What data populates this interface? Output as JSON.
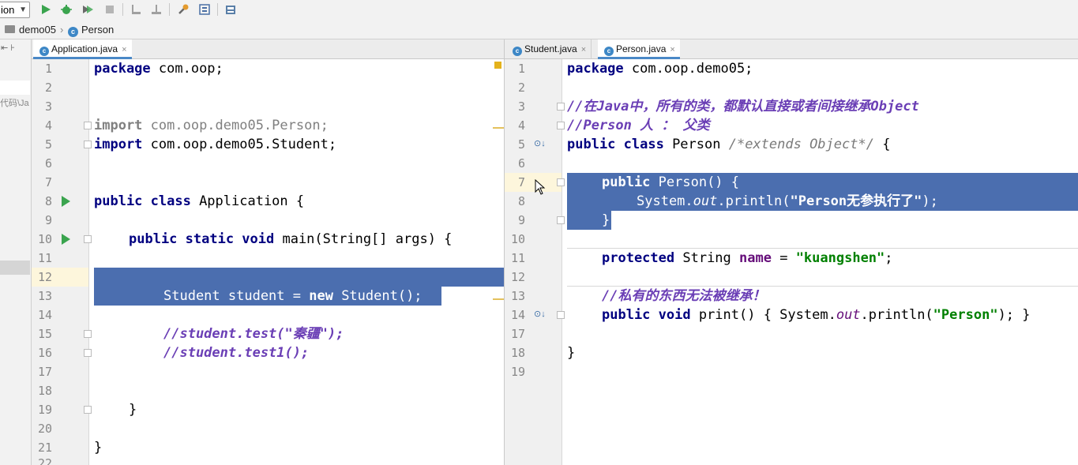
{
  "toolbar": {
    "run_config": "ion",
    "icons": [
      "run-icon",
      "debug-icon",
      "coverage-icon",
      "stop-icon",
      "build-icon",
      "rebuild-icon",
      "settings-icon",
      "structure-icon",
      "sdk-icon"
    ]
  },
  "breadcrumb": {
    "items": [
      "demo05",
      "Person"
    ]
  },
  "left_strip": {
    "label": "代码\\Ja"
  },
  "left_editor": {
    "tabs": [
      {
        "label": "Application.java",
        "active": true
      }
    ],
    "lines": [
      "1",
      "2",
      "3",
      "4",
      "5",
      "6",
      "7",
      "8",
      "9",
      "10",
      "11",
      "12",
      "13",
      "14",
      "15",
      "16",
      "17",
      "18",
      "19",
      "20",
      "21",
      "22"
    ],
    "code": {
      "l1_kw": "package",
      "l1_rest": " com.oop;",
      "l4_kw": "import",
      "l4_rest": " com.oop.demo05.Person;",
      "l5_kw": "import",
      "l5_rest": " com.oop.demo05.Student;",
      "l8_kw": "public class",
      "l8_rest": " Application {",
      "l10_kw1": "public static void",
      "l10_rest": " main(String[] args) {",
      "l13_a": "Student student = ",
      "l13_kw": "new",
      "l13_b": " Student();",
      "l15": "//student.test(\"秦疆\");",
      "l16": "//student.test1();",
      "l19": "}",
      "l21": "}"
    }
  },
  "right_editor": {
    "tabs": [
      {
        "label": "Student.java",
        "active": false
      },
      {
        "label": "Person.java",
        "active": true
      }
    ],
    "lines": [
      "1",
      "2",
      "3",
      "4",
      "5",
      "6",
      "7",
      "8",
      "9",
      "10",
      "11",
      "12",
      "13",
      "14",
      "17",
      "18",
      "19"
    ],
    "code": {
      "l1_kw": "package",
      "l1_rest": " com.oop.demo05;",
      "l3": "//在Java中，所有的类，都默认直接或者间接继承Object",
      "l4": "//Person 人 ： 父类",
      "l5_kw": "public class",
      "l5_rest": " Person ",
      "l5_cmt": "/*extends Object*/",
      "l5_end": " {",
      "l7_kw": "public",
      "l7_rest": " Person() {",
      "l8_a": "System.",
      "l8_out": "out",
      "l8_b": ".println(",
      "l8_str": "\"Person无参执行了\"",
      "l8_c": ");",
      "l9": "}",
      "l11_kw": "protected",
      "l11_rest": " String ",
      "l11_field": "name",
      "l11_eq": " = ",
      "l11_str": "\"kuangshen\"",
      "l11_end": ";",
      "l13": "//私有的东西无法被继承！",
      "l14_kw": "public void",
      "l14_a": " print() { System.",
      "l14_out": "out",
      "l14_b": ".println(",
      "l14_str": "\"Person\"",
      "l14_c": "); }",
      "l18": "}"
    }
  },
  "colors": {
    "selection": "#4b6eaf",
    "keyword": "#000080",
    "string": "#008000",
    "comment": "#6a3eb5"
  }
}
